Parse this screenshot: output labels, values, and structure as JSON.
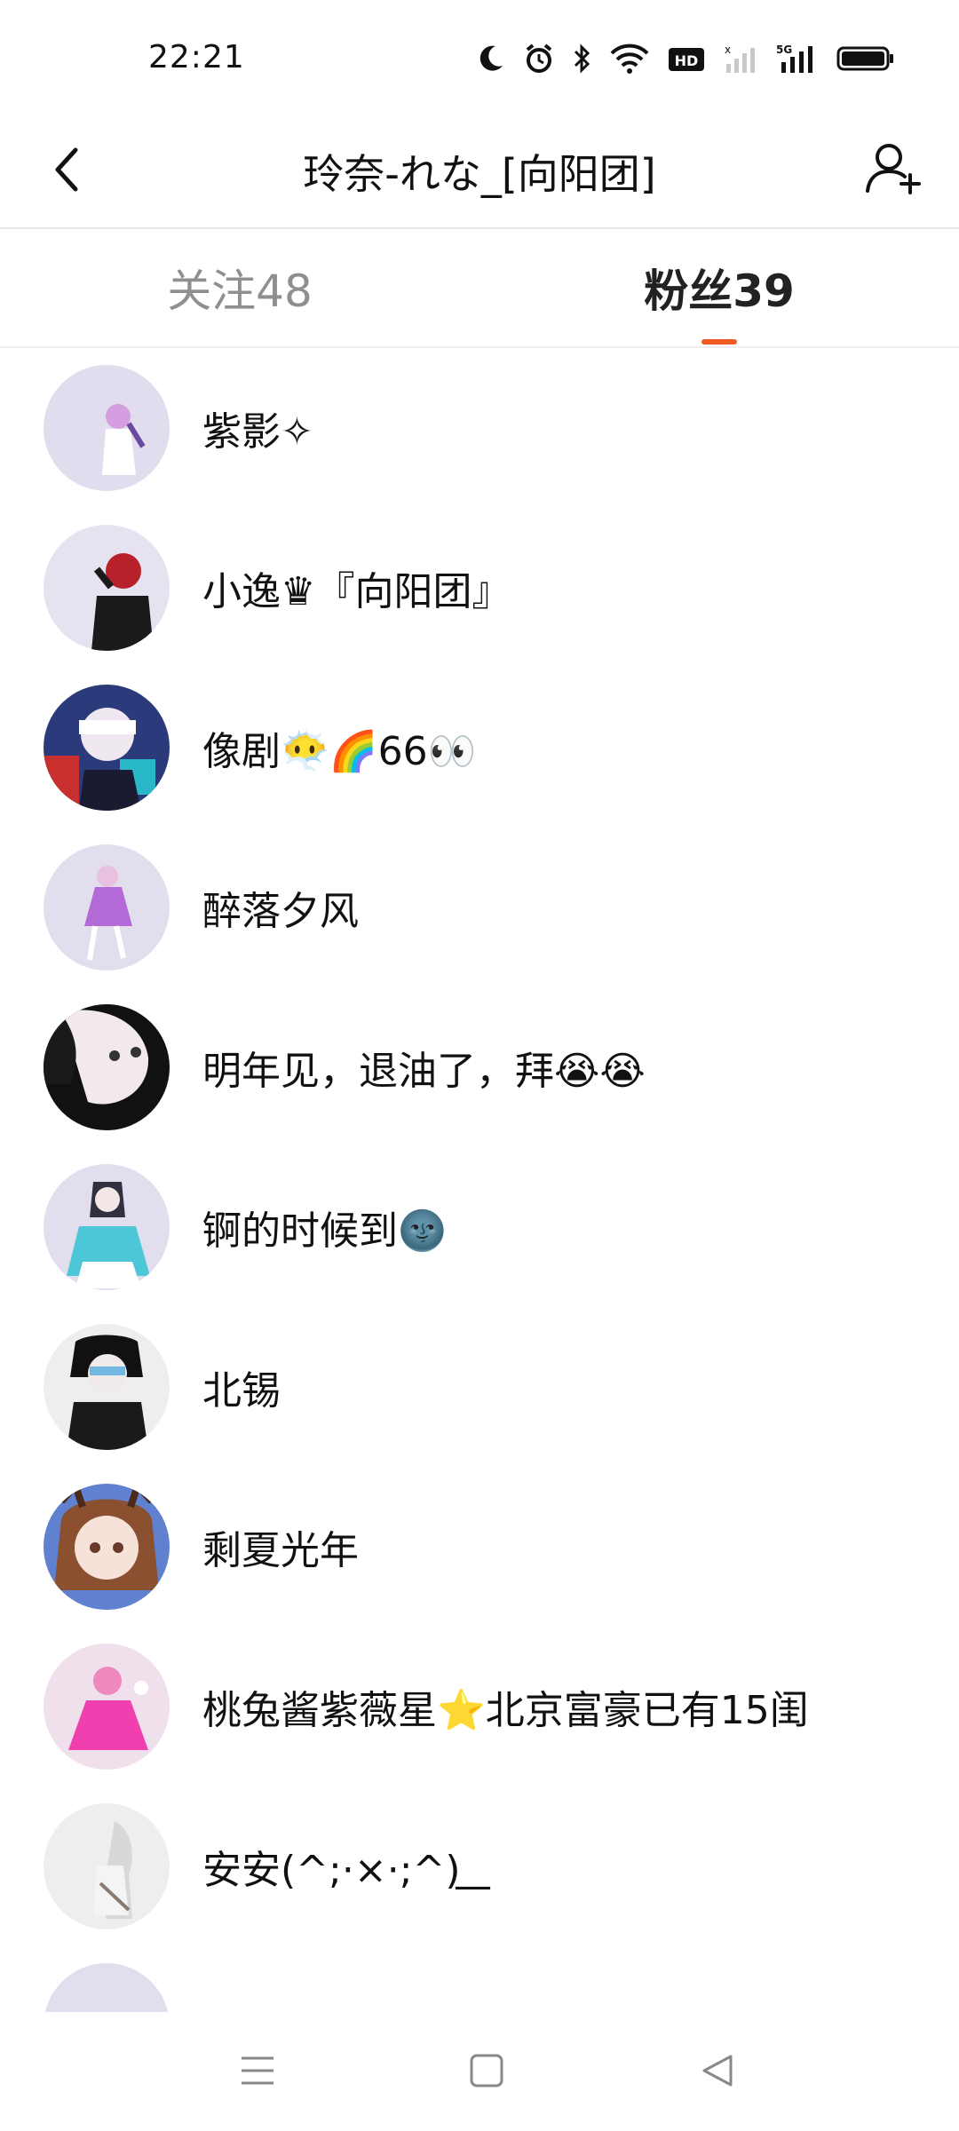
{
  "status_bar": {
    "time": "22:21",
    "icons": [
      "moon-icon",
      "alarm-icon",
      "bluetooth-icon",
      "wifi-icon",
      "hd-icon",
      "signal-icon",
      "5g-signal-icon",
      "battery-icon"
    ]
  },
  "header": {
    "title": "玲奈-れな_[向阳团]",
    "back_icon": "chevron-left-icon",
    "action_icon": "add-user-icon"
  },
  "tabs": [
    {
      "label": "关注48",
      "active": false
    },
    {
      "label": "粉丝39",
      "active": true
    }
  ],
  "accent_color": "#f15a24",
  "followers": [
    {
      "name": "紫影✧"
    },
    {
      "name": "小逸♛『向阳团』"
    },
    {
      "name": "像剧😶‍🌫️🌈66👀"
    },
    {
      "name": "醉落夕风"
    },
    {
      "name": "明年见，退油了，拜😭😭"
    },
    {
      "name": "锕的时候到🌚"
    },
    {
      "name": "北锡"
    },
    {
      "name": "剩夏光年"
    },
    {
      "name": "桃兔酱紫薇星⭐北京富豪已有15闺"
    },
    {
      "name": "安安(^;·×·;^) ͟"
    }
  ],
  "nav_bar": [
    "menu-icon",
    "home-icon",
    "back-icon"
  ]
}
